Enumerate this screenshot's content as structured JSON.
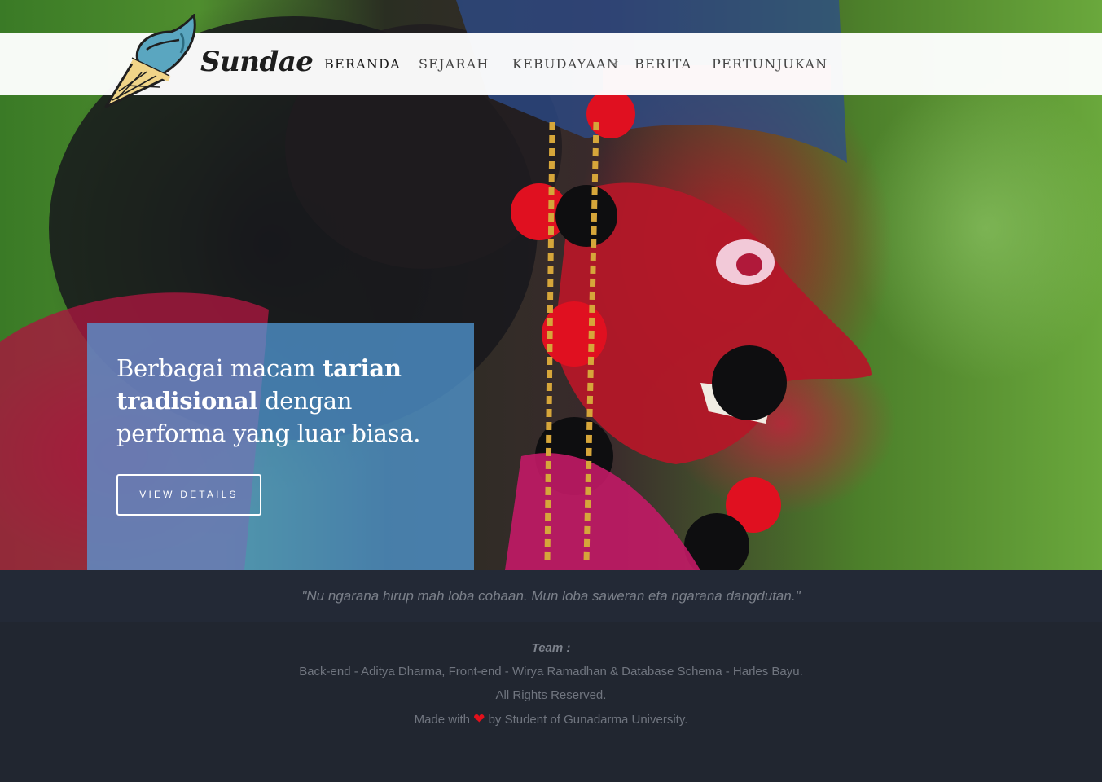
{
  "nav": {
    "brand": "Sundae",
    "items": [
      {
        "label": "BERANDA"
      },
      {
        "label": "SEJARAH"
      },
      {
        "label": "KEBUDAYAAN"
      },
      {
        "label": "BERITA"
      },
      {
        "label": "PERTUNJUKAN"
      }
    ]
  },
  "hero": {
    "caption_part1": "Berbagai macam ",
    "caption_bold": "tarian tradisional",
    "caption_part2": " dengan performa yang luar biasa.",
    "button_label": "VIEW DETAILS"
  },
  "footer": {
    "quote": "\"Nu ngarana hirup mah loba cobaan. Mun loba saweran eta ngarana dangdutan.\"",
    "team_label": "Team :",
    "credits": "Back-end - Aditya Dharma, Front-end - Wirya Ramadhan & Database Schema - Harles Bayu.",
    "rights": "All Rights Reserved.",
    "made_prefix": "Made with",
    "heart": "❤",
    "made_suffix": "by Student of Gunadarma University."
  },
  "colors": {
    "caption_bg": "#539ede",
    "footer_bg": "#212630",
    "heart": "#e3101b"
  }
}
